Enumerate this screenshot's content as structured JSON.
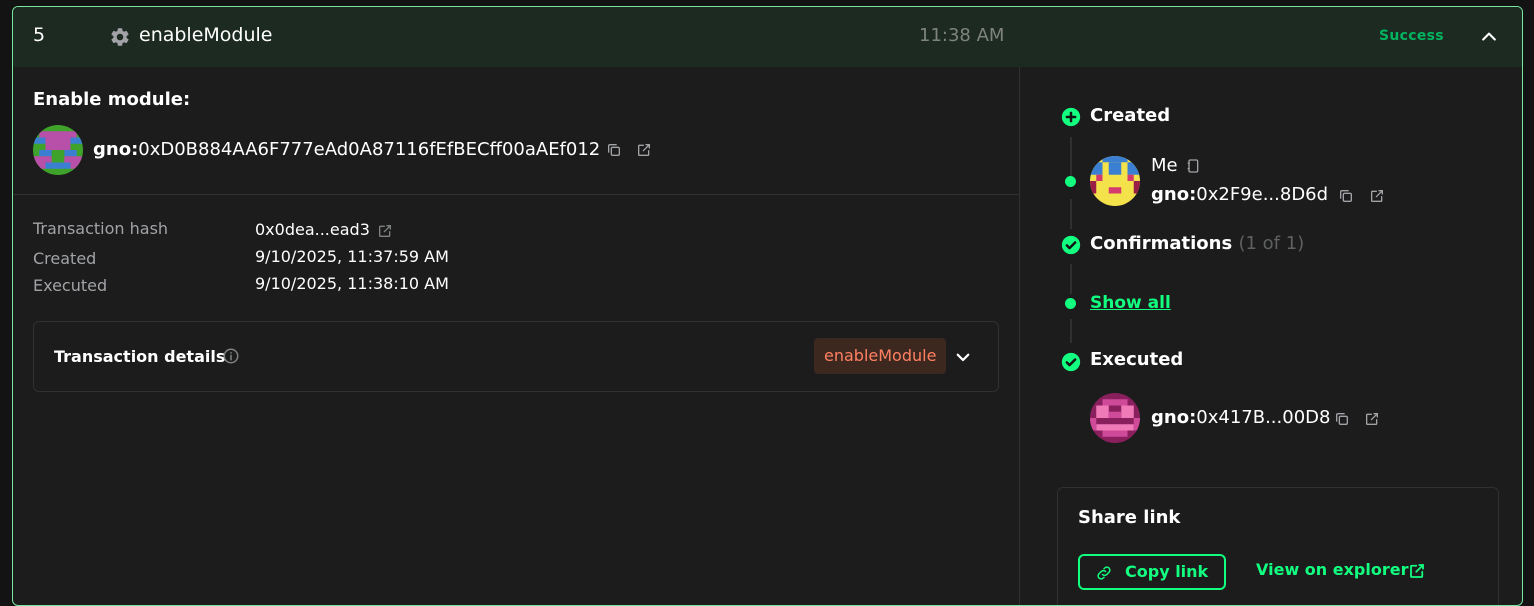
{
  "header": {
    "nonce": "5",
    "tx_type": "enableModule",
    "time": "11:38 AM",
    "status": "Success"
  },
  "main": {
    "title": "Enable module:",
    "module_address": {
      "prefix": "gno:",
      "address": "0xD0B884AA6F777eAd0A87116fEfBECff00aAEf012"
    },
    "info": [
      {
        "label": "Transaction hash",
        "value": "0x0dea...ead3"
      },
      {
        "label": "Created",
        "value": "9/10/2025, 11:37:59 AM"
      },
      {
        "label": "Executed",
        "value": "9/10/2025, 11:38:10 AM"
      }
    ],
    "tx_details": {
      "label": "Transaction details",
      "method": "enableModule"
    }
  },
  "timeline": {
    "created_label": "Created",
    "creator_name": "Me",
    "creator_prefix": "gno:",
    "creator_address": "0x2F9e...8D6d",
    "confirmations_label": "Confirmations",
    "confirmations_count": "(1 of 1)",
    "show_all": "Show all",
    "executed_label": "Executed",
    "executor_prefix": "gno:",
    "executor_address": "0x417B...00D8"
  },
  "share": {
    "title": "Share link",
    "copy_label": "Copy link",
    "explorer_label": "View on explorer"
  },
  "colors": {
    "accent": "#12ff80",
    "success": "#00b460",
    "border": "#7ae7a1",
    "method_chip_text": "#ff8061"
  }
}
